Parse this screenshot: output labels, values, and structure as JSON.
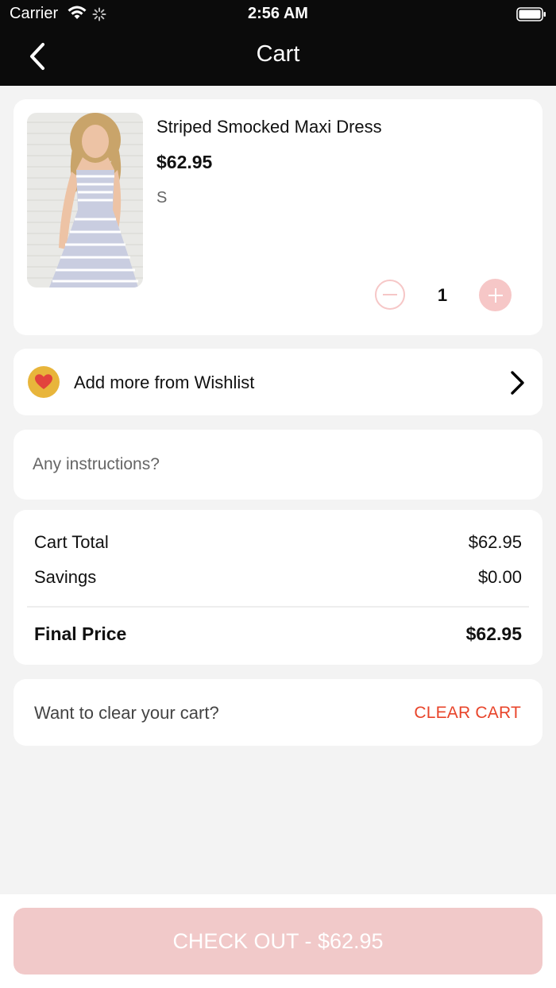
{
  "status_bar": {
    "carrier": "Carrier",
    "time": "2:56 AM",
    "icons": [
      "wifi-icon",
      "spinner-icon",
      "battery-icon"
    ]
  },
  "nav": {
    "title": "Cart",
    "back_icon": "chevron-left-icon"
  },
  "cart_item": {
    "name": "Striped Smocked Maxi Dress",
    "price": "$62.95",
    "size": "S",
    "quantity": "1",
    "image": "product-photo"
  },
  "wishlist": {
    "label": "Add more from Wishlist",
    "icon": "heart-icon",
    "chevron": "chevron-right-icon"
  },
  "instructions": {
    "placeholder": "Any instructions?",
    "value": ""
  },
  "totals": {
    "cart_total_label": "Cart Total",
    "cart_total_value": "$62.95",
    "savings_label": "Savings",
    "savings_value": "$0.00",
    "final_label": "Final Price",
    "final_value": "$62.95"
  },
  "clear": {
    "label": "Want to clear your cart?",
    "button": "CLEAR CART"
  },
  "checkout": {
    "label": "CHECK OUT - $62.95"
  },
  "colors": {
    "header": "#0b0b0b",
    "accent": "#e8442a",
    "checkout_disabled": "#f1c9c9",
    "stepper": "#f6c7c7",
    "wishlist_icon_bg": "#e8b53b"
  }
}
